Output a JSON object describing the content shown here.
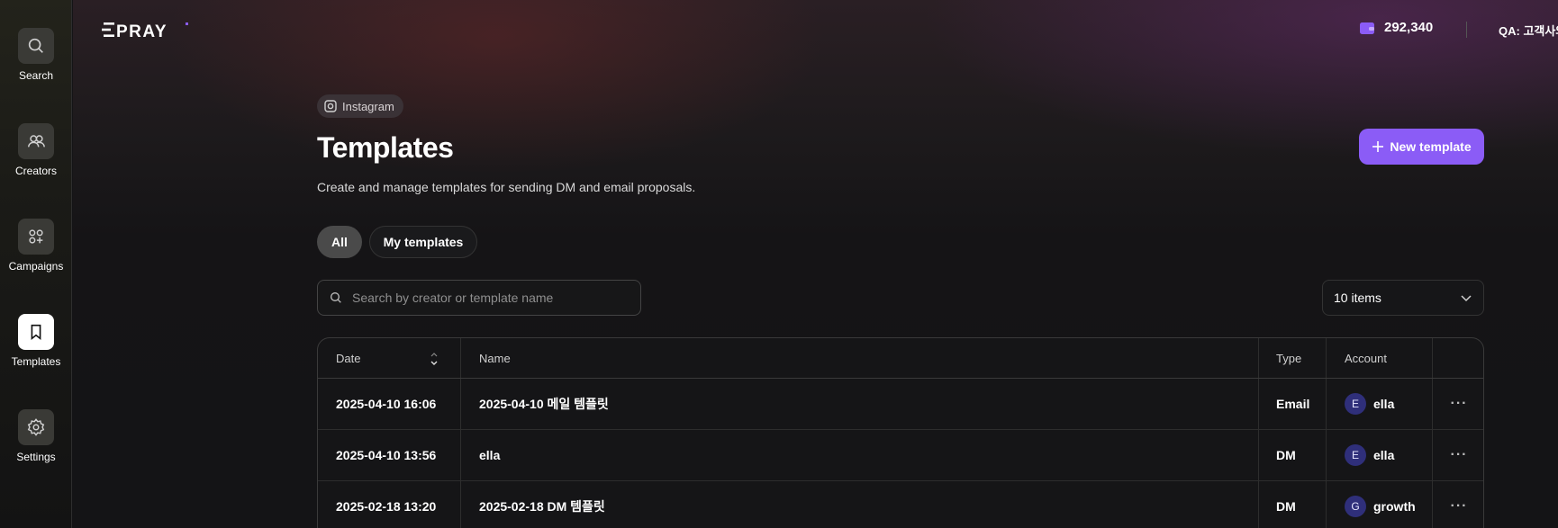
{
  "app": {
    "logo_text": "EPRAY"
  },
  "sidebar": {
    "items": [
      {
        "label": "Search",
        "icon": "search-icon"
      },
      {
        "label": "Creators",
        "icon": "users-icon"
      },
      {
        "label": "Campaigns",
        "icon": "campaigns-icon"
      },
      {
        "label": "Templates",
        "icon": "bookmark-icon",
        "active": true
      },
      {
        "label": "Settings",
        "icon": "gear-icon"
      }
    ]
  },
  "header": {
    "credits": "292,340",
    "credits_icon": "wallet-icon",
    "account": "QA: 고객사와"
  },
  "page": {
    "platform": "Instagram",
    "title": "Templates",
    "description": "Create and manage templates for sending DM and email proposals.",
    "new_button": "New template"
  },
  "tabs": [
    {
      "label": "All",
      "active": true
    },
    {
      "label": "My templates",
      "active": false
    }
  ],
  "search": {
    "placeholder": "Search by creator or template name",
    "value": ""
  },
  "page_size": {
    "selected": "10 items"
  },
  "table": {
    "columns": {
      "date": "Date",
      "name": "Name",
      "type": "Type",
      "account": "Account"
    },
    "rows": [
      {
        "date": "2025-04-10 16:06",
        "name": "2025-04-10 메일 템플릿",
        "type": "Email",
        "account_initial": "E",
        "account": "ella",
        "more": "···"
      },
      {
        "date": "2025-04-10 13:56",
        "name": "ella",
        "type": "DM",
        "account_initial": "E",
        "account": "ella",
        "more": "···"
      },
      {
        "date": "2025-02-18 13:20",
        "name": "2025-02-18 DM 템플릿",
        "type": "DM",
        "account_initial": "G",
        "account": "growth",
        "more": "···"
      }
    ]
  },
  "colors": {
    "accent": "#8b5cf6",
    "background": "#141416",
    "avatar_bg": "#2f2f7a",
    "wallet": "#8b5cf6"
  }
}
